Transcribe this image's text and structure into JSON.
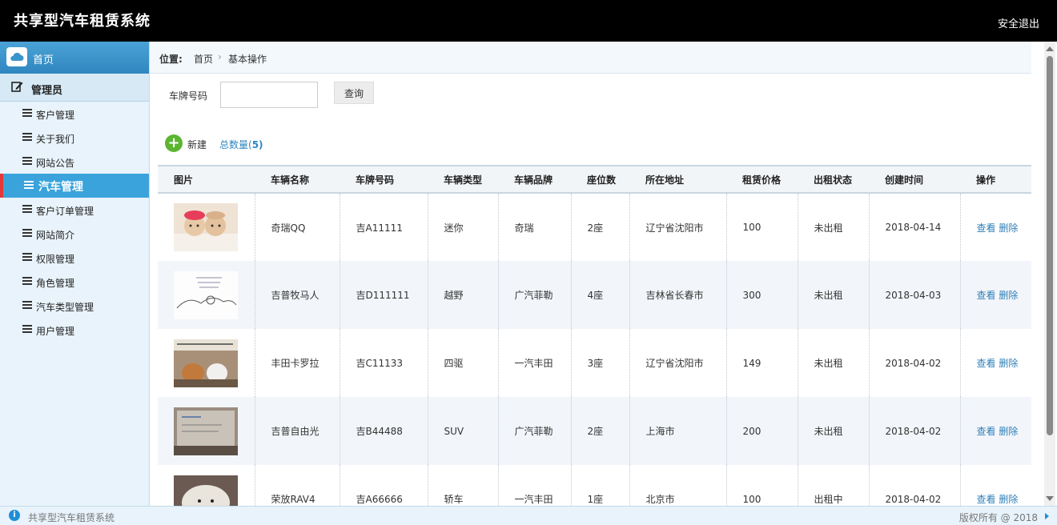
{
  "header": {
    "title": "共享型汽车租赁系统",
    "logout": "安全退出"
  },
  "sidebar": {
    "home": "首页",
    "admin": "管理员",
    "items": [
      {
        "label": "客户管理",
        "active": false
      },
      {
        "label": "关于我们",
        "active": false
      },
      {
        "label": "网站公告",
        "active": false
      },
      {
        "label": "汽车管理",
        "active": true
      },
      {
        "label": "客户订单管理",
        "active": false
      },
      {
        "label": "网站简介",
        "active": false
      },
      {
        "label": "权限管理",
        "active": false
      },
      {
        "label": "角色管理",
        "active": false
      },
      {
        "label": "汽车类型管理",
        "active": false
      },
      {
        "label": "用户管理",
        "active": false
      }
    ]
  },
  "breadcrumb": {
    "position_label": "位置:",
    "home": "首页",
    "separator": "›",
    "current": "基本操作"
  },
  "search": {
    "label": "车牌号码",
    "value": "",
    "button": "查询"
  },
  "toolbar": {
    "new_label": "新建",
    "total_label": "总数量(",
    "total_count": "5",
    "total_close": ")"
  },
  "table": {
    "columns": [
      "图片",
      "车辆名称",
      "车牌号码",
      "车辆类型",
      "车辆品牌",
      "座位数",
      "所在地址",
      "租赁价格",
      "出租状态",
      "创建时间",
      "操作"
    ],
    "rows": [
      {
        "image": "cute-dolls-photo",
        "name": "奇瑞QQ",
        "plate": "吉A11111",
        "type": "迷你",
        "brand": "奇瑞",
        "seats": "2座",
        "address": "辽宁省沈阳市",
        "price": "100",
        "status": "未出租",
        "created": "2018-04-14",
        "view": "查看",
        "delete": "删除"
      },
      {
        "image": "sketch-drawing",
        "name": "吉普牧马人",
        "plate": "吉D111111",
        "type": "越野",
        "brand": "广汽菲勒",
        "seats": "4座",
        "address": "吉林省长春市",
        "price": "300",
        "status": "未出租",
        "created": "2018-04-03",
        "view": "查看",
        "delete": "删除"
      },
      {
        "image": "cats-photo",
        "name": "丰田卡罗拉",
        "plate": "吉C11133",
        "type": "四驱",
        "brand": "一汽丰田",
        "seats": "3座",
        "address": "辽宁省沈阳市",
        "price": "149",
        "status": "未出租",
        "created": "2018-04-02",
        "view": "查看",
        "delete": "删除"
      },
      {
        "image": "screen-photo",
        "name": "吉普自由光",
        "plate": "吉B44488",
        "type": "SUV",
        "brand": "广汽菲勒",
        "seats": "2座",
        "address": "上海市",
        "price": "200",
        "status": "未出租",
        "created": "2018-04-02",
        "view": "查看",
        "delete": "删除"
      },
      {
        "image": "dog-photo",
        "name": "荣放RAV4",
        "plate": "吉A66666",
        "type": "轿车",
        "brand": "一汽丰田",
        "seats": "1座",
        "address": "北京市",
        "price": "100",
        "status": "出租中",
        "created": "2018-04-02",
        "view": "查看",
        "delete": "删除"
      }
    ]
  },
  "footer": {
    "system_name": "共享型汽车租赁系统",
    "copyright": "版权所有 @ 2018"
  },
  "colors": {
    "topbar": "#000000",
    "sidebar_active": "#3aa3dc",
    "active_marker": "#e23a3a",
    "link": "#2f7fb8",
    "add_icon": "#5cb531"
  }
}
